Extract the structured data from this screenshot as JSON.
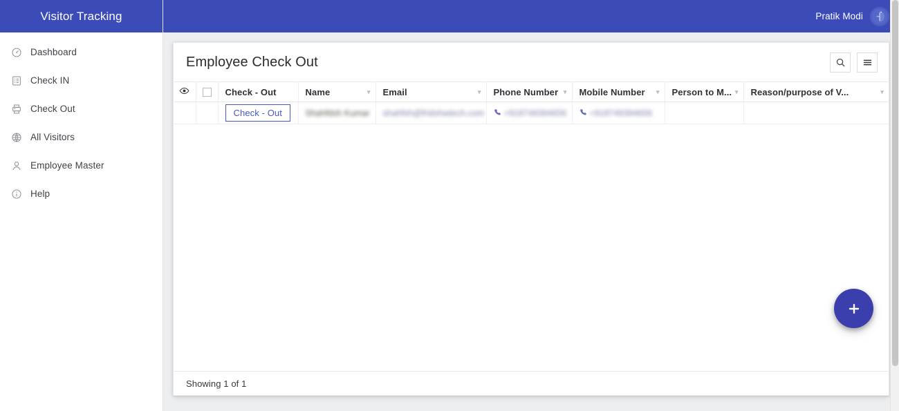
{
  "app": {
    "brand_title": "Visitor Tracking",
    "accent_color": "#3b4cb8",
    "fab_color": "#3b3fae",
    "content_bg": "#eceef0"
  },
  "topbar": {
    "user_name": "Pratik Modi",
    "avatar_icon": "user-avatar-logo"
  },
  "sidebar": {
    "items": [
      {
        "label": "Dashboard",
        "icon": "gauge-icon"
      },
      {
        "label": "Check IN",
        "icon": "form-list-icon"
      },
      {
        "label": "Check Out",
        "icon": "printer-icon"
      },
      {
        "label": "All Visitors",
        "icon": "globe-icon"
      },
      {
        "label": "Employee Master",
        "icon": "person-icon"
      },
      {
        "label": "Help",
        "icon": "info-circle-icon"
      }
    ]
  },
  "card": {
    "title": "Employee Check Out",
    "actions": [
      {
        "name": "search",
        "icon": "search-icon"
      },
      {
        "name": "menu",
        "icon": "hamburger-menu-icon"
      }
    ],
    "fab": {
      "label": "+",
      "icon": "plus-icon"
    },
    "footer_text": "Showing 1 of 1"
  },
  "table": {
    "columns": [
      {
        "label": "",
        "key": "eye",
        "icon": "eye-icon",
        "sortable": false
      },
      {
        "label": "",
        "key": "select",
        "icon": "checkbox-icon",
        "sortable": false
      },
      {
        "label": "Check - Out",
        "key": "checkout",
        "sortable": false
      },
      {
        "label": "Name",
        "key": "name",
        "sortable": true
      },
      {
        "label": "Email",
        "key": "email",
        "sortable": true
      },
      {
        "label": "Phone Number",
        "key": "phone",
        "sortable": true
      },
      {
        "label": "Mobile Number",
        "key": "mobile",
        "sortable": true
      },
      {
        "label": "Person to M...",
        "key": "person_to_meet",
        "sortable": true
      },
      {
        "label": "Reason/purpose of V...",
        "key": "reason",
        "sortable": true
      }
    ],
    "rows": [
      {
        "checkout_label": "Check - Out",
        "name": "Shahfdsh Kumar",
        "email": "shahfsh@fridshwtech.com",
        "phone": "+918749394656",
        "mobile": "+918749394656",
        "person_to_meet": "",
        "reason": "",
        "redacted": true
      }
    ]
  }
}
